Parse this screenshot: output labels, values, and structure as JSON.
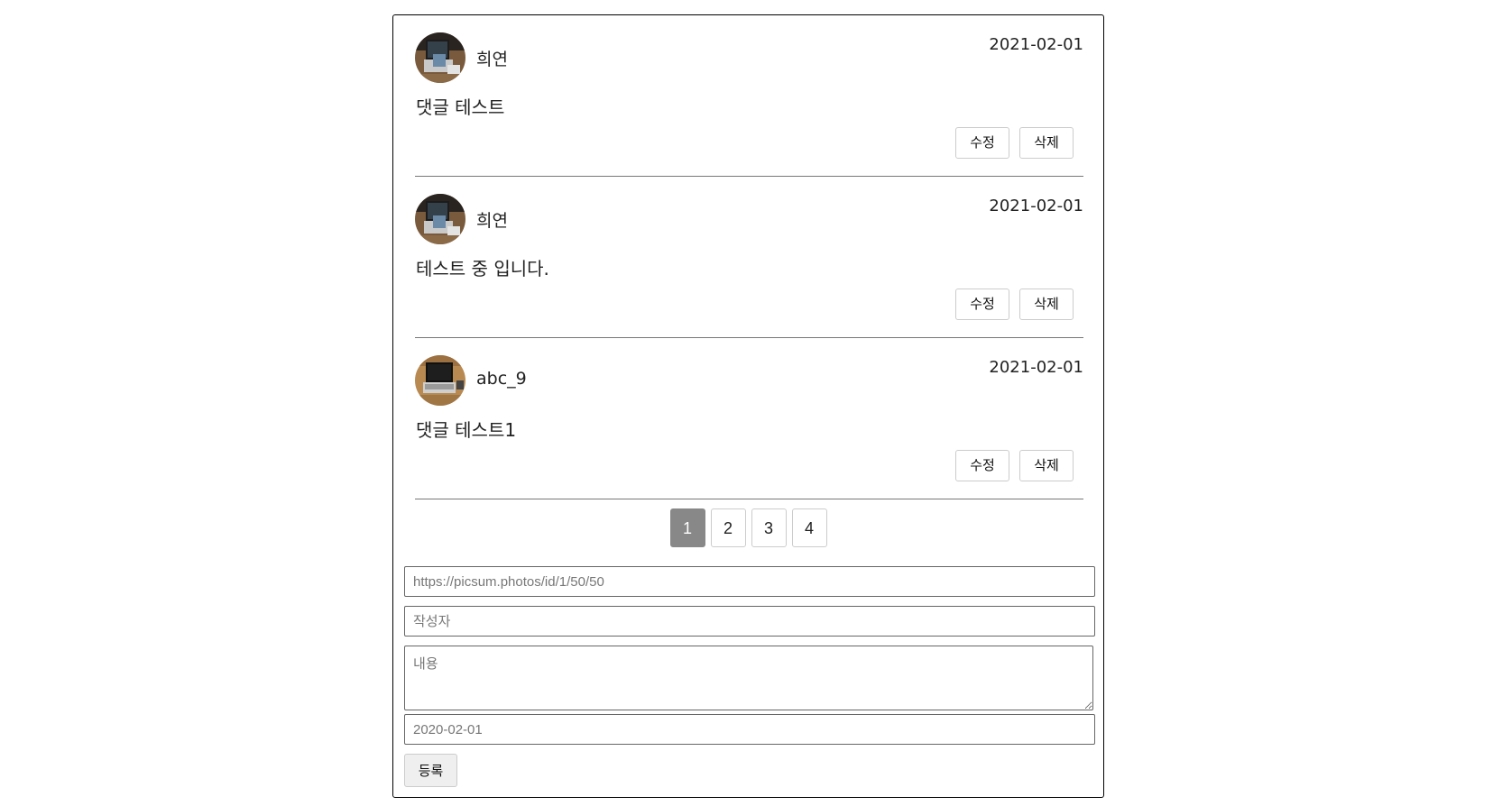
{
  "comments": [
    {
      "author": "희연",
      "date": "2021-02-01",
      "content": "댓글 테스트",
      "edit_label": "수정",
      "delete_label": "삭제",
      "avatar_icon": "laptop-photo-avatar"
    },
    {
      "author": "희연",
      "date": "2021-02-01",
      "content": "테스트 중 입니다.",
      "edit_label": "수정",
      "delete_label": "삭제",
      "avatar_icon": "laptop-photo-avatar"
    },
    {
      "author": "abc_9",
      "date": "2021-02-01",
      "content": "댓글 테스트1",
      "edit_label": "수정",
      "delete_label": "삭제",
      "avatar_icon": "laptop-photo-avatar"
    }
  ],
  "pagination": {
    "pages": [
      "1",
      "2",
      "3",
      "4"
    ],
    "current": "1",
    "active_color": "#888888"
  },
  "form": {
    "image_url_placeholder": "https://picsum.photos/id/1/50/50",
    "author_placeholder": "작성자",
    "content_placeholder": "내용",
    "date_placeholder": "2020-02-01",
    "submit_label": "등록"
  }
}
